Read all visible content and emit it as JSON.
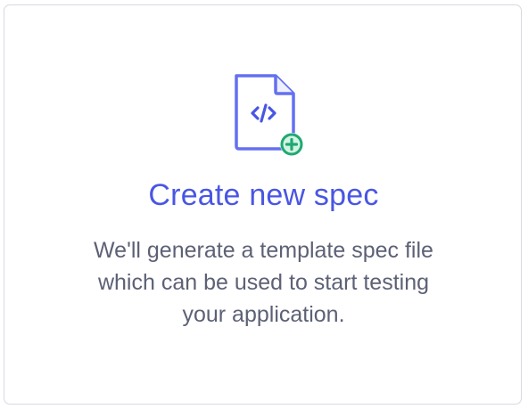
{
  "card": {
    "title": "Create new spec",
    "description_lines": [
      "We'll generate a template spec file",
      "which can be used to start testing",
      "your application."
    ],
    "icon": "file-code-add-icon",
    "colors": {
      "title": "#4956e3",
      "description": "#5d6175",
      "icon_stroke": "#6470f0",
      "add_badge": "#1fa971",
      "border": "#d7d9e2"
    }
  }
}
